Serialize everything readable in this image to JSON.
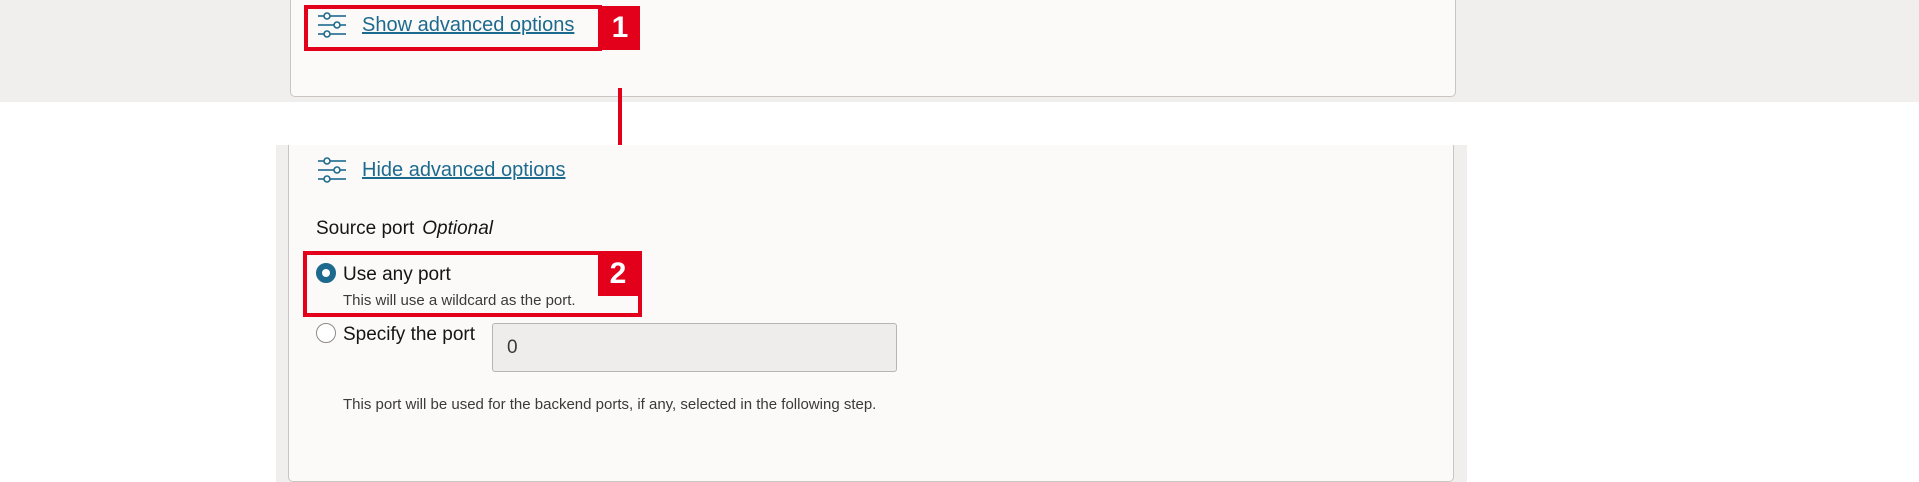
{
  "top": {
    "link_label": "Show advanced options"
  },
  "bottom": {
    "link_label": "Hide advanced options",
    "source_port_label": "Source port",
    "source_port_optional": "Optional",
    "options": [
      {
        "label": "Use any port",
        "help": "This will use a wildcard as the port.",
        "selected": true
      },
      {
        "label": "Specify the port",
        "selected": false
      }
    ],
    "port_value": "0",
    "port_help": "This port will be used for the backend ports, if any, selected in the following step."
  },
  "callouts": [
    {
      "number": "1"
    },
    {
      "number": "2"
    }
  ],
  "colors": {
    "accent": "#1d6a8f",
    "callout": "#e3001b"
  },
  "icons": {
    "adv": "sliders-icon",
    "arrow": "arrow-down-icon"
  }
}
